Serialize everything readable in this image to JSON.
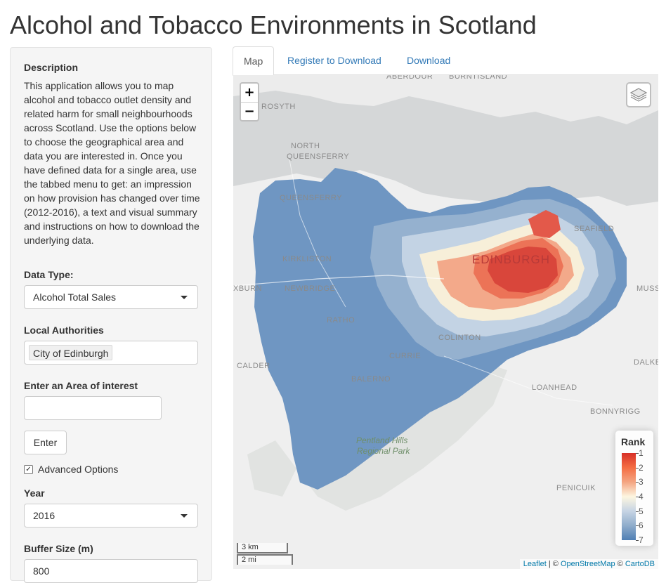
{
  "page": {
    "title": "Alcohol and Tobacco Environments in Scotland"
  },
  "sidebar": {
    "description_label": "Description",
    "description_text": "This application allows you to map alcohol and tobacco outlet density and related harm for small neighbourhoods across Scotland. Use the options below to choose the geographical area and data you are interested in. Once you have defined data for a single area, use the tabbed menu to get: an impression on how provision has changed over time (2012-2016), a text and visual summary and instructions on how to download the underlying data.",
    "data_type_label": "Data Type:",
    "data_type_value": "Alcohol Total Sales",
    "local_authorities_label": "Local Authorities",
    "local_authorities_value": "City of Edinburgh",
    "area_label": "Enter an Area of interest",
    "area_value": "",
    "enter_button": "Enter",
    "advanced_options_label": "Advanced Options",
    "advanced_options_checked": true,
    "year_label": "Year",
    "year_value": "2016",
    "buffer_label": "Buffer Size (m)",
    "buffer_value": "800"
  },
  "tabs": [
    {
      "label": "Map",
      "active": true
    },
    {
      "label": "Register to Download",
      "active": false
    },
    {
      "label": "Download",
      "active": false
    }
  ],
  "map": {
    "zoom_in": "+",
    "zoom_out": "−",
    "place_labels": {
      "aberdour": "ABERDOUR",
      "burntisland": "BURNTISLAND",
      "rosyth": "ROSYTH",
      "north": "NORTH",
      "queensferry": "QUEENSFERRY",
      "queensferry_south": "QUEENSFERRY",
      "kirkliston": "KIRKLISTON",
      "newbridge": "NEWBRIDGE",
      "broxburn": "XBURN",
      "ratho": "RATHO",
      "edinburgh": "EDINBURGH",
      "seafield": "SEAFIELD",
      "musselburgh": "MUSSI",
      "colinton": "COLINTON",
      "currie": "CURRIE",
      "calder": "CALDER",
      "balerno": "BALERNO",
      "loanhead": "LOANHEAD",
      "dalkeith": "DALKEI",
      "bonnyrigg": "BONNYRIGG",
      "penicuik": "PENICUIK",
      "pentland_1": "Pentland Hills",
      "pentland_2": "Regional Park"
    },
    "legend": {
      "title": "Rank",
      "ticks": [
        "1",
        "2",
        "3",
        "4",
        "5",
        "6",
        "7"
      ],
      "colors": [
        "#d73027",
        "#f46d43",
        "#f4a582",
        "#fdf6e0",
        "#c6d4e4",
        "#8faccb",
        "#4f7fb4"
      ]
    },
    "scale_km": "3 km",
    "scale_mi": "2 mi",
    "attribution": {
      "leaflet": "Leaflet",
      "sep1": " | © ",
      "osm": "OpenStreetMap",
      "sep2": " © ",
      "carto": "CartoDB"
    }
  }
}
